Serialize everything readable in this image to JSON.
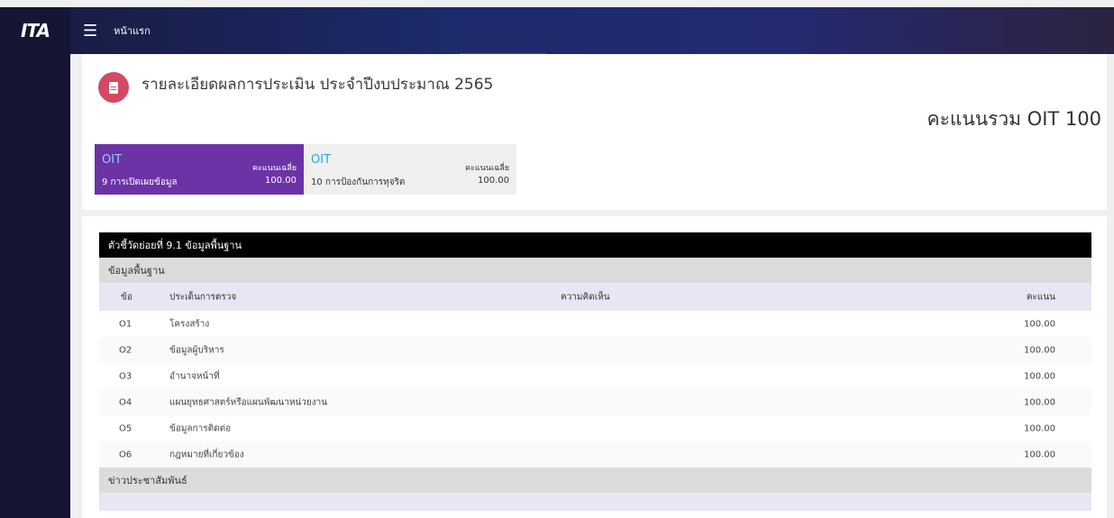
{
  "nav": {
    "logo": "ITA",
    "home_label": "หน้าแรก"
  },
  "header": {
    "title": "รายละเอียดผลการประเมิน ประจำปีงบประมาณ 2565",
    "total_score": "คะแนนรวม OIT 100"
  },
  "tabs": [
    {
      "code": "OIT",
      "avg_label": "คะแนนเฉลี่ย",
      "name": "9 การเปิดเผยข้อมูล",
      "avg": "100.00"
    },
    {
      "code": "OIT",
      "avg_label": "คะแนนเฉลี่ย",
      "name": "10 การป้องกันการทุจริต",
      "avg": "100.00"
    }
  ],
  "table": {
    "indicator": "ตัวชี้วัดย่อยที่ 9.1 ข้อมูลพื้นฐาน",
    "sections": [
      {
        "name": "ข้อมูลพื้นฐาน"
      },
      {
        "name": "ข่าวประชาสัมพันธ์"
      }
    ],
    "columns": {
      "no": "ข้อ",
      "topic": "ประเด็นการตรวจ",
      "comment": "ความคิดเห็น",
      "score": "คะแนน"
    },
    "rows": [
      {
        "no": "O1",
        "topic": "โครงสร้าง",
        "comment": "",
        "score": "100.00"
      },
      {
        "no": "O2",
        "topic": "ข้อมูลผู้บริหาร",
        "comment": "",
        "score": "100.00"
      },
      {
        "no": "O3",
        "topic": "อำนาจหน้าที่",
        "comment": "",
        "score": "100.00"
      },
      {
        "no": "O4",
        "topic": "แผนยุทธศาสตร์หรือแผนพัฒนาหน่วยงาน",
        "comment": "",
        "score": "100.00"
      },
      {
        "no": "O5",
        "topic": "ข้อมูลการติดต่อ",
        "comment": "",
        "score": "100.00"
      },
      {
        "no": "O6",
        "topic": "กฎหมายที่เกี่ยวข้อง",
        "comment": "",
        "score": "100.00"
      }
    ]
  },
  "colors": {
    "navbar": "#1d2a6b",
    "sidebar": "#141634",
    "active_tab": "#6b33a6",
    "badge": "#d24a63"
  }
}
